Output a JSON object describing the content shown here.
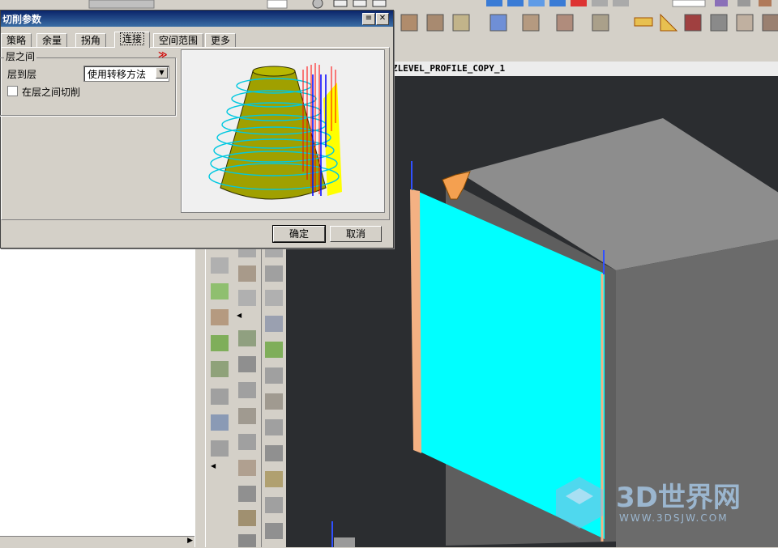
{
  "dialog": {
    "title": "切削参数",
    "tabs": [
      {
        "label": "策略"
      },
      {
        "label": "余量"
      },
      {
        "label": "拐角"
      },
      {
        "label": "连接"
      },
      {
        "label": "空间范围"
      },
      {
        "label": "更多"
      }
    ],
    "active_tab": "连接",
    "group_title": "层之间",
    "layer_to_layer_label": "层到层",
    "layer_to_layer_value": "使用转移方法",
    "cut_between_layers_label": "在层之间切削",
    "cut_between_layers_checked": false,
    "ok_label": "确定",
    "cancel_label": "取消"
  },
  "viewport": {
    "title": "ZLEVEL_PROFILE_COPY_1",
    "background_color": "#2b2d30",
    "wall_color": "#00ffff",
    "block_color": "#6b6b6b"
  },
  "watermark": {
    "text": "3D世界网",
    "url": "WWW.3DSJW.COM"
  }
}
